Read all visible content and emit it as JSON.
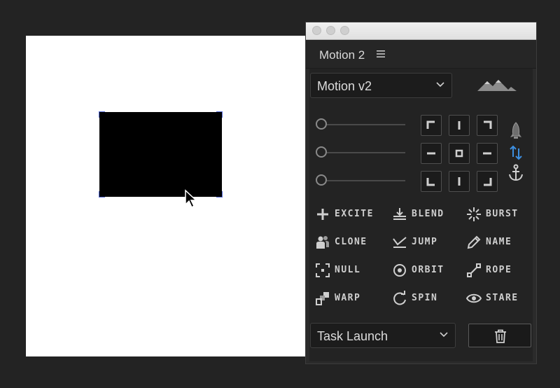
{
  "panel": {
    "title": "Motion 2",
    "preset_select": {
      "value": "Motion v2"
    },
    "task_select": {
      "value": "Task Launch"
    }
  },
  "anchor_grid": [
    "top-left",
    "top-center",
    "top-right",
    "middle-left",
    "center",
    "middle-right",
    "bottom-left",
    "bottom-center",
    "bottom-right"
  ],
  "side_icons": [
    "rocket-icon",
    "swap-arrows-icon",
    "anchor-icon"
  ],
  "tools": [
    {
      "label": "EXCITE",
      "icon": "plus-icon"
    },
    {
      "label": "BLEND",
      "icon": "blend-icon"
    },
    {
      "label": "BURST",
      "icon": "burst-icon"
    },
    {
      "label": "CLONE",
      "icon": "clone-icon"
    },
    {
      "label": "JUMP",
      "icon": "jump-icon"
    },
    {
      "label": "NAME",
      "icon": "pencil-icon"
    },
    {
      "label": "NULL",
      "icon": "null-icon"
    },
    {
      "label": "ORBIT",
      "icon": "orbit-icon"
    },
    {
      "label": "ROPE",
      "icon": "rope-icon"
    },
    {
      "label": "WARP",
      "icon": "warp-icon"
    },
    {
      "label": "SPIN",
      "icon": "spin-icon"
    },
    {
      "label": "STARE",
      "icon": "eye-icon"
    }
  ],
  "colors": {
    "selection": "#5a6fd8",
    "accent": "#3d8fe0",
    "panel_bg": "#232323"
  }
}
